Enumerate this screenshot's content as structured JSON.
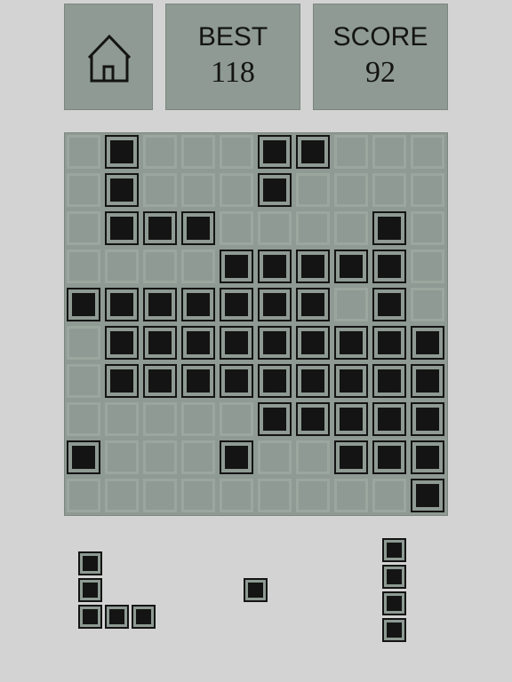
{
  "header": {
    "home_icon": "home-icon",
    "best_label": "BEST",
    "best_value": "118",
    "score_label": "SCORE",
    "score_value": "92"
  },
  "board": {
    "rows": 10,
    "cols": 10,
    "grid": [
      "0100011000",
      "0100010000",
      "0111000010",
      "0000111110",
      "1111111010",
      "0111111111",
      "0111111111",
      "0000011111",
      "1000100111",
      "0000000001"
    ]
  },
  "pieces": [
    {
      "name": "piece-l-shape",
      "cells": [
        [
          0,
          0
        ],
        [
          1,
          0
        ],
        [
          2,
          0
        ],
        [
          2,
          1
        ],
        [
          2,
          2
        ]
      ]
    },
    {
      "name": "piece-single",
      "cells": [
        [
          0,
          0
        ]
      ]
    },
    {
      "name": "piece-i-vertical",
      "cells": [
        [
          0,
          0
        ],
        [
          1,
          0
        ],
        [
          2,
          0
        ],
        [
          3,
          0
        ]
      ]
    }
  ],
  "colors": {
    "background": "#d3d3d3",
    "panel": "#8e9a93",
    "block": "#141414",
    "empty_cell_border": "#9ba69f"
  }
}
